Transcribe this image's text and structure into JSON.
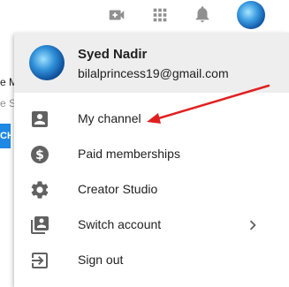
{
  "topbar": {
    "icons": [
      "video-camera-add-icon",
      "apps-grid-icon",
      "bell-icon",
      "avatar"
    ]
  },
  "background": {
    "fragment_title": "e M",
    "fragment_sub": "e St",
    "fragment_button": "CH"
  },
  "account": {
    "name": "Syed Nadir",
    "email": "bilalprincess19@gmail.com"
  },
  "menu": {
    "items": [
      {
        "label": "My channel",
        "icon": "person-icon"
      },
      {
        "label": "Paid memberships",
        "icon": "dollar-icon"
      },
      {
        "label": "Creator Studio",
        "icon": "gear-icon"
      },
      {
        "label": "Switch account",
        "icon": "switch-account-icon",
        "has_submenu": true
      },
      {
        "label": "Sign out",
        "icon": "sign-out-icon"
      }
    ]
  },
  "annotation": {
    "arrow_color": "#e02020"
  },
  "colors": {
    "icon": "#616161",
    "header_bg": "#eeeeee",
    "text": "#212121"
  }
}
